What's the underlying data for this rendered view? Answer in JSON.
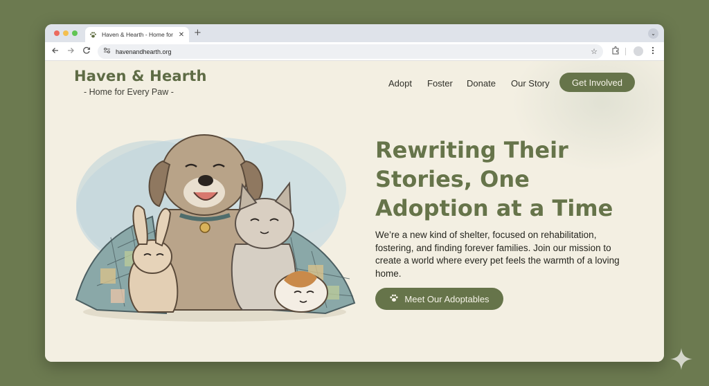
{
  "browser": {
    "tab_title": "Haven & Hearth - Home for",
    "tab_close": "✕",
    "new_tab": "+",
    "tab_menu": "⌄",
    "url": "havenandhearth.org",
    "icons": [
      "paw-favicon-icon",
      "back-icon",
      "forward-icon",
      "reload-icon",
      "site-info-icon",
      "bookmark-star-icon",
      "extensions-icon",
      "profile-icon",
      "menu-kebab-icon"
    ]
  },
  "site": {
    "logo_title": "Haven & Hearth",
    "logo_subtitle": "- Home for Every Paw -",
    "nav": [
      "Adopt",
      "Foster",
      "Donate",
      "Our Story"
    ],
    "nav_cta": "Get Involved",
    "headline": "Rewriting Their Stories, One Adoption at a Time",
    "intro": "We’re a new kind of shelter, focused on rehabilitation, fostering, and finding forever families. Join our mission to create a world where every pet feels the warmth of a loving home.",
    "cta": "Meet Our Adoptables",
    "cta_icon": "paw-icon"
  },
  "colors": {
    "brand_green": "#66744a",
    "page_cream": "#f3efe2",
    "desktop_bg": "#6c7a50"
  }
}
